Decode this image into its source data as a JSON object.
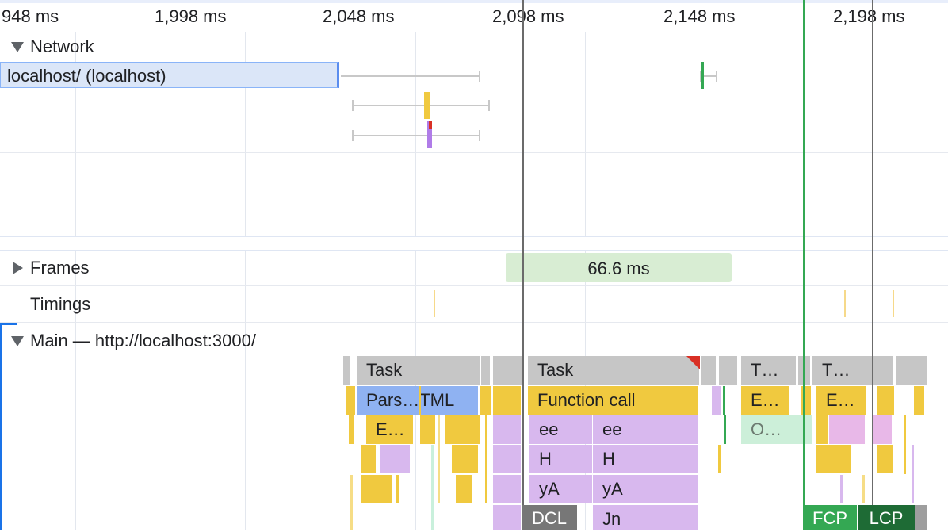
{
  "ruler": {
    "ticks": [
      "948 ms",
      "1,998 ms",
      "2,048 ms",
      "2,098 ms",
      "2,148 ms",
      "2,198 ms"
    ]
  },
  "tracks": {
    "network": "Network",
    "frames": "Frames",
    "timings": "Timings",
    "main": "Main — http://localhost:3000/"
  },
  "network": {
    "request_label": "localhost/ (localhost)"
  },
  "frames": {
    "frame_duration": "66.6 ms"
  },
  "flame": {
    "task_1": "Task",
    "task_2": "Task",
    "task_3": "T…",
    "task_4": "T…",
    "parse_html": "Pars…TML",
    "function_call": "Function call",
    "e_1": "E…",
    "e_2": "E…",
    "e_3": "E…",
    "o_1": "O…",
    "ee_1": "ee",
    "ee_2": "ee",
    "h_1": "H",
    "h_2": "H",
    "ya_1": "yA",
    "ya_2": "yA",
    "jn": "Jn"
  },
  "markers": {
    "dcl": "DCL",
    "fcp": "FCP",
    "lcp": "LCP"
  },
  "colors": {
    "task": "#c6c6c6",
    "scripting": "#f0c93f",
    "parse": "#8fb2f2",
    "rendering": "#d8b8ee",
    "fcp": "#34a853",
    "lcp": "#1e6b35",
    "dcl": "#6b6b6b"
  }
}
